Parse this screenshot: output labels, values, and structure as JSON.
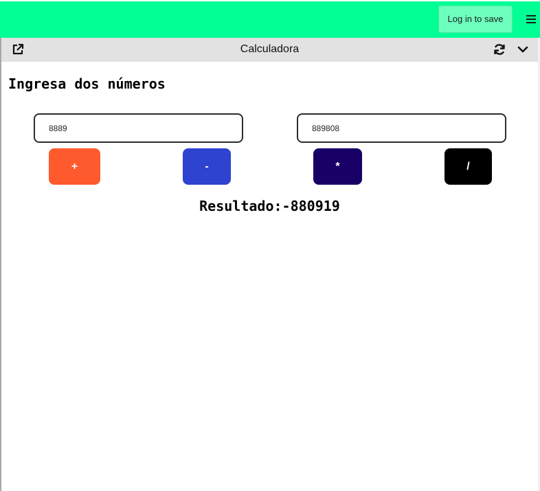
{
  "colors": {
    "topbar": "#00ff94",
    "login_button": "#6dffbd",
    "panel_header": "#e2e2e2",
    "add_button": "#ff5a2e",
    "subtract_button": "#2e43d0",
    "multiply_button": "#180067",
    "divide_button": "#000000"
  },
  "topbar": {
    "login_label": "Log in to save",
    "menu_icon": "hamburger-menu-icon"
  },
  "panel": {
    "title": "Calculadora",
    "open_icon": "external-link-icon",
    "refresh_icon": "refresh-icon",
    "collapse_icon": "chevron-down-icon"
  },
  "calculator": {
    "heading": "Ingresa dos números",
    "input1_value": "8889",
    "input2_value": "889808",
    "buttons": {
      "add": "+",
      "subtract": "-",
      "multiply": "*",
      "divide": "/"
    },
    "result_text": "Resultado:-880919"
  }
}
